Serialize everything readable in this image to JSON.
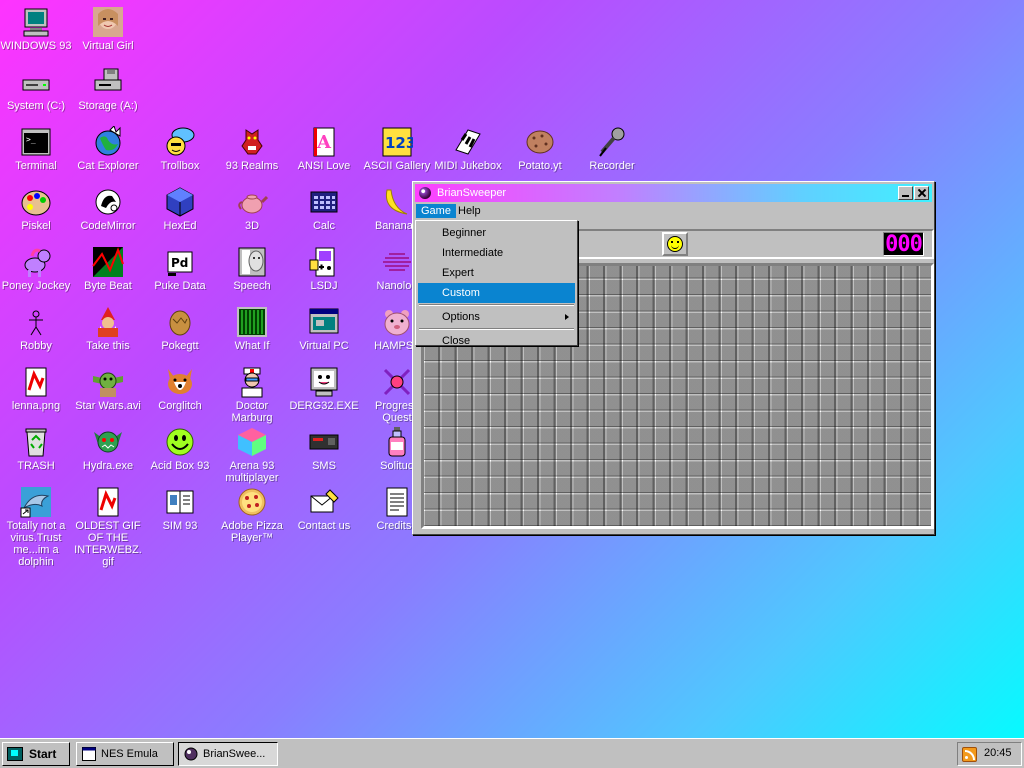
{
  "desktop": {
    "icons": [
      {
        "label": "WINDOWS 93",
        "icon": "computer-icon"
      },
      {
        "label": "Virtual Girl",
        "icon": "face-photo-icon"
      },
      {
        "label": "System (C:)",
        "icon": "hard-drive-icon"
      },
      {
        "label": "Storage (A:)",
        "icon": "floppy-drive-icon"
      },
      {
        "label": "Terminal",
        "icon": "terminal-icon"
      },
      {
        "label": "Cat Explorer",
        "icon": "globe-cat-icon"
      },
      {
        "label": "Trollbox",
        "icon": "chat-bubble-icon"
      },
      {
        "label": "93 Realms",
        "icon": "dragon-icon"
      },
      {
        "label": "ANSI Love",
        "icon": "ansi-letter-icon"
      },
      {
        "label": "ASCII Gallery",
        "icon": "numbers-icon"
      },
      {
        "label": "MIDI Jukebox",
        "icon": "piano-keys-icon"
      },
      {
        "label": "Potato.yt",
        "icon": "potato-icon"
      },
      {
        "label": "Recorder",
        "icon": "microphone-icon"
      },
      {
        "label": "Piskel",
        "icon": "paint-palette-icon"
      },
      {
        "label": "CodeMirror",
        "icon": "mirror-icon"
      },
      {
        "label": "HexEd",
        "icon": "hex-cube-icon"
      },
      {
        "label": "3D",
        "icon": "teapot-icon"
      },
      {
        "label": "Calc",
        "icon": "calculator-icon"
      },
      {
        "label": "Bananan",
        "icon": "banana-icon"
      },
      {
        "label": "Poney Jockey",
        "icon": "pony-icon"
      },
      {
        "label": "Byte Beat",
        "icon": "waveform-icon"
      },
      {
        "label": "Puke Data",
        "icon": "pd-patch-icon"
      },
      {
        "label": "Speech",
        "icon": "speech-face-icon"
      },
      {
        "label": "LSDJ",
        "icon": "gameboy-icon"
      },
      {
        "label": "Nanolog",
        "icon": "wave-lines-icon"
      },
      {
        "label": "Robby",
        "icon": "stick-figure-icon"
      },
      {
        "label": "Take this",
        "icon": "gnome-icon"
      },
      {
        "label": "Pokegtt",
        "icon": "egg-icon"
      },
      {
        "label": "What If",
        "icon": "green-grid-icon"
      },
      {
        "label": "Virtual PC",
        "icon": "virtual-pc-icon"
      },
      {
        "label": "HAMPST",
        "icon": "hamster-icon"
      },
      {
        "label": "lenna.png",
        "icon": "image-file-icon"
      },
      {
        "label": "Star Wars.avi",
        "icon": "yoda-icon"
      },
      {
        "label": "Corglitch",
        "icon": "corgi-icon"
      },
      {
        "label": "Doctor Marburg",
        "icon": "doctor-icon"
      },
      {
        "label": "DERG32.EXE",
        "icon": "monitor-face-icon"
      },
      {
        "label": "Progress Quest",
        "icon": "crossed-swords-icon"
      },
      {
        "label": "TRASH",
        "icon": "recycle-bin-icon"
      },
      {
        "label": "Hydra.exe",
        "icon": "hydra-icon"
      },
      {
        "label": "Acid Box 93",
        "icon": "acid-smiley-icon"
      },
      {
        "label": "Arena 93 multiplayer",
        "icon": "color-cube-icon"
      },
      {
        "label": "SMS",
        "icon": "console-icon"
      },
      {
        "label": "Solitud",
        "icon": "bottle-icon"
      },
      {
        "label": "Totally not a virus.Trust me...im a dolphin",
        "icon": "dolphin-icon"
      },
      {
        "label": "OLDEST GIF OF THE INTERWEBZ.gif",
        "icon": "gif-file-icon"
      },
      {
        "label": "SIM 93",
        "icon": "sim-book-icon"
      },
      {
        "label": "Adobe Pizza Player™",
        "icon": "pizza-icon"
      },
      {
        "label": "Contact us",
        "icon": "envelope-pen-icon"
      },
      {
        "label": "Credits.t",
        "icon": "text-doc-icon"
      }
    ]
  },
  "window": {
    "title": "BrianSweeper",
    "menu": {
      "game": "Game",
      "help": "Help"
    },
    "mine_counter": "000",
    "dropdown": {
      "items": [
        "Beginner",
        "Intermediate",
        "Expert",
        "Custom"
      ],
      "active": "Custom",
      "options": "Options",
      "close": "Close"
    }
  },
  "taskbar": {
    "start": "Start",
    "tasks": [
      "NES Emula",
      "BrianSwee..."
    ],
    "clock": "20:45"
  },
  "colors": {
    "accent": "#0a84d0",
    "counter_digits": "#ff00ff"
  }
}
